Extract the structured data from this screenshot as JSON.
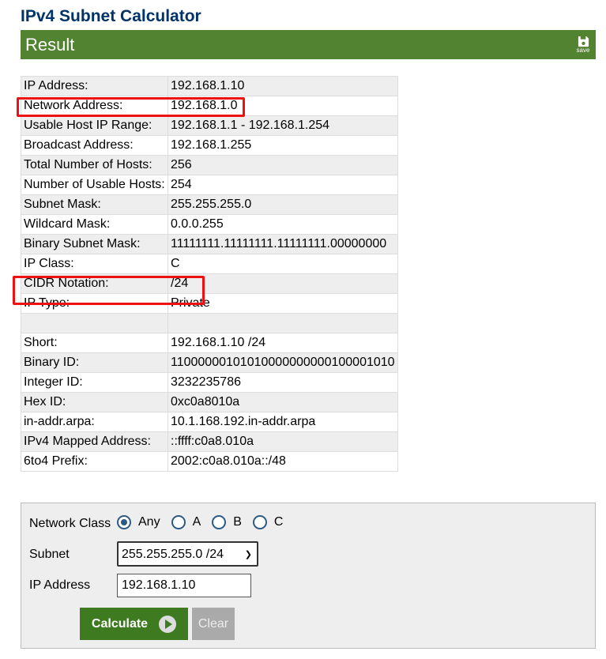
{
  "page": {
    "title": "IPv4 Subnet Calculator"
  },
  "result_bar": {
    "label": "Result",
    "save_label": "save"
  },
  "results": [
    {
      "key": "IP Address:",
      "value": "192.168.1.10"
    },
    {
      "key": "Network Address:",
      "value": "192.168.1.0"
    },
    {
      "key": "Usable Host IP Range:",
      "value": "192.168.1.1 - 192.168.1.254"
    },
    {
      "key": "Broadcast Address:",
      "value": "192.168.1.255"
    },
    {
      "key": "Total Number of Hosts:",
      "value": "256"
    },
    {
      "key": "Number of Usable Hosts:",
      "value": "254"
    },
    {
      "key": "Subnet Mask:",
      "value": "255.255.255.0"
    },
    {
      "key": "Wildcard Mask:",
      "value": "0.0.0.255"
    },
    {
      "key": "Binary Subnet Mask:",
      "value": "11111111.11111111.11111111.00000000"
    },
    {
      "key": "IP Class:",
      "value": "C"
    },
    {
      "key": "CIDR Notation:",
      "value": "/24"
    },
    {
      "key": "IP Type:",
      "value": "Private"
    },
    {
      "key": "",
      "value": ""
    },
    {
      "key": "Short:",
      "value": "192.168.1.10 /24"
    },
    {
      "key": "Binary ID:",
      "value": "11000000101010000000000100001010"
    },
    {
      "key": "Integer ID:",
      "value": "3232235786"
    },
    {
      "key": "Hex ID:",
      "value": "0xc0a8010a"
    },
    {
      "key": "in-addr.arpa:",
      "value": "10.1.168.192.in-addr.arpa"
    },
    {
      "key": "IPv4 Mapped Address:",
      "value": "::ffff:c0a8.010a"
    },
    {
      "key": "6to4 Prefix:",
      "value": "2002:c0a8.010a::/48"
    }
  ],
  "form": {
    "network_class_label": "Network Class",
    "classes": [
      {
        "label": "Any",
        "checked": true
      },
      {
        "label": "A",
        "checked": false
      },
      {
        "label": "B",
        "checked": false
      },
      {
        "label": "C",
        "checked": false
      }
    ],
    "subnet_label": "Subnet",
    "subnet_value": "255.255.255.0 /24",
    "ip_label": "IP Address",
    "ip_value": "192.168.1.10",
    "calculate_label": "Calculate",
    "clear_label": "Clear"
  },
  "colors": {
    "title": "#003366",
    "result_bar": "#518330",
    "highlight": "#ee1111",
    "calculate_button": "#3e7a1f",
    "clear_button": "#aaaaaa"
  },
  "icons": {
    "save": "floppy-disk-icon",
    "calculate": "play-circle-icon",
    "select": "chevron-down-icon"
  }
}
